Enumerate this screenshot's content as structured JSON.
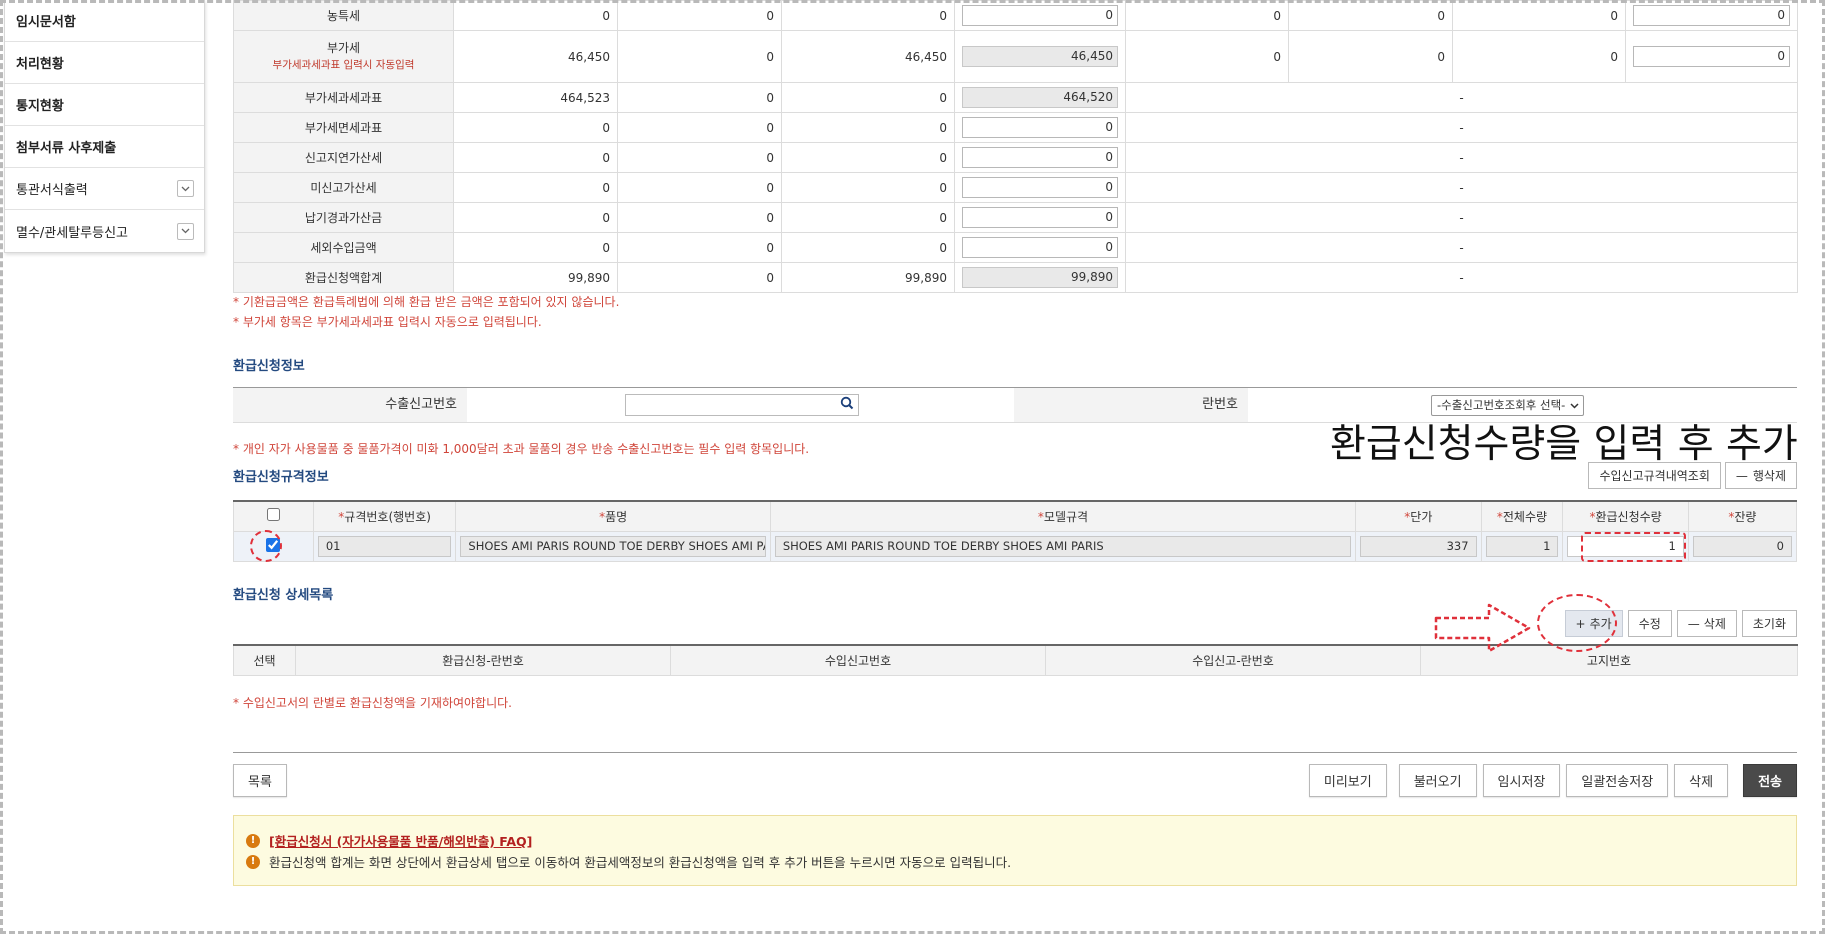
{
  "sidebar": {
    "items": [
      {
        "label": "임시문서함",
        "bold": true,
        "chevron": false
      },
      {
        "label": "처리현황",
        "bold": true,
        "chevron": false
      },
      {
        "label": "통지현황",
        "bold": true,
        "chevron": false
      },
      {
        "label": "첨부서류 사후제출",
        "bold": true,
        "chevron": false
      },
      {
        "label": "통관서식출력",
        "bold": false,
        "chevron": true
      },
      {
        "label": "멸수/관세탈루등신고",
        "bold": false,
        "chevron": true
      }
    ]
  },
  "tax_table": {
    "rows": [
      {
        "label": "농특세",
        "c1": "0",
        "c2": "0",
        "c3": "0",
        "input": "0",
        "d1": "0",
        "d2": "0",
        "d3": "0",
        "d4": "0"
      },
      {
        "label": "부가세",
        "sublabel": "부가세과세과표 입력시 자동입력",
        "c1": "46,450",
        "c2": "0",
        "c3": "46,450",
        "input": "46,450",
        "d1": "0",
        "d2": "0",
        "d3": "0",
        "d4": "0"
      },
      {
        "label": "부가세과세과표",
        "c1": "464,523",
        "c2": "0",
        "c3": "0",
        "input": "464,520",
        "dash": "-"
      },
      {
        "label": "부가세면세과표",
        "c1": "0",
        "c2": "0",
        "c3": "0",
        "input": "0",
        "dash": "-"
      },
      {
        "label": "신고지연가산세",
        "c1": "0",
        "c2": "0",
        "c3": "0",
        "input": "0",
        "dash": "-"
      },
      {
        "label": "미신고가산세",
        "c1": "0",
        "c2": "0",
        "c3": "0",
        "input": "0",
        "dash": "-"
      },
      {
        "label": "납기경과가산금",
        "c1": "0",
        "c2": "0",
        "c3": "0",
        "input": "0",
        "dash": "-"
      },
      {
        "label": "세외수입금액",
        "c1": "0",
        "c2": "0",
        "c3": "0",
        "input": "0",
        "dash": "-"
      },
      {
        "label": "환급신청액합계",
        "c1": "99,890",
        "c2": "0",
        "c3": "99,890",
        "input": "99,890",
        "dash": "-"
      }
    ],
    "notes": [
      "* 기환급금액은 환급특례법에 의해 환급 받은 금액은 포함되어 있지 않습니다.",
      "* 부가세 항목은 부가세과세과표 입력시 자동으로 입력됩니다."
    ]
  },
  "refund_info": {
    "title": "환급신청정보",
    "export_label": "수출신고번호",
    "export_value": "",
    "line_label": "란번호",
    "line_select": "-수출신고번호조회후 선택-",
    "note": "* 개인 자가 사용물품 중 물품가격이 미화 1,000달러 초과 물품의 경우 반송 수출신고번호는 필수 입력 항목입니다."
  },
  "annotation": "환급신청수량을 입력 후 추가",
  "spec_info": {
    "title": "환급신청규격정보",
    "btn_lookup": "수입신고규격내역조회",
    "btn_delete_row": "행삭제",
    "headers": [
      "규격번호(행번호)",
      "품명",
      "모델규격",
      "단가",
      "전체수량",
      "환급신청수량",
      "잔량"
    ],
    "row": {
      "spec_no": "01",
      "name": "SHOES AMI PARIS ROUND TOE DERBY SHOES   AMI PARIS",
      "model": "SHOES AMI PARIS ROUND TOE DERBY SHOES   AMI PARIS",
      "price": "337",
      "total_qty": "1",
      "refund_qty": "1",
      "remain": "0"
    }
  },
  "detail_list": {
    "title": "환급신청 상세목록",
    "btn_add": "추가",
    "btn_edit": "수정",
    "btn_delete": "삭제",
    "btn_reset": "초기화",
    "headers": [
      "선택",
      "환급신청-란번호",
      "수입신고번호",
      "수입신고-란번호",
      "고지번호"
    ],
    "note": "* 수입신고서의 란별로 환급신청액을 기재하여야합니다."
  },
  "footer": {
    "btn_list": "목록",
    "btn_preview": "미리보기",
    "btn_load": "불러오기",
    "btn_temp_save": "임시저장",
    "btn_batch_save": "일괄전송저장",
    "btn_delete": "삭제",
    "btn_send": "전송"
  },
  "faq": {
    "link": "[환급신청서 (자가사용물품 반품/해외반출) FAQ]",
    "message": "환급신청액 합계는 화면 상단에서 환급상세 탭으로 이동하여 환급세액정보의 환급신청액을 입력 후 추가 버튼을 누르시면 자동으로 입력됩니다."
  },
  "colors": {
    "note_red": "#d0453a",
    "section_blue": "#244a80",
    "annotation_red": "#e0303a",
    "send_button": "#4a4a4a"
  }
}
